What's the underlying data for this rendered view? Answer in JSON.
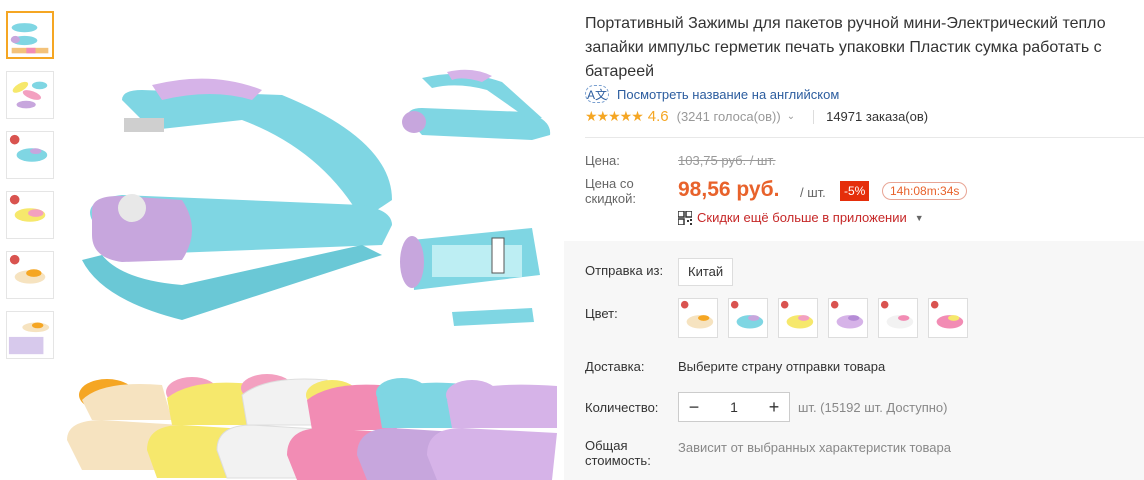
{
  "product": {
    "title": "Портативный Зажимы для пакетов ручной мини-Электрический тепло запайки импульс герметик печать упаковки Пластик сумка работать с батареей",
    "translate_link": "Посмотреть название на английском",
    "translate_icon": "translate-icon",
    "rating": {
      "stars": "★★★★★",
      "value": "4.6",
      "votes": "(3241 голоса(ов))",
      "orders": "14971 заказа(ов)"
    }
  },
  "pricing": {
    "price_label": "Цена:",
    "old_price": "103,75 руб. / шт.",
    "discount_label": "Цена со скидкой:",
    "new_price": "98,56 руб.",
    "per_unit": "/ шт.",
    "discount_badge": "-5%",
    "timer": "14h:08m:34s",
    "app_deal": "Скидки ещё больше в приложении"
  },
  "options": {
    "ship_from_label": "Отправка из:",
    "ship_from_value": "Китай",
    "color_label": "Цвет:",
    "color_swatches": [
      "orange",
      "blue",
      "pink",
      "purple",
      "violet",
      "yellow"
    ],
    "delivery_label": "Доставка:",
    "delivery_value": "Выберите страну отправки товара",
    "quantity_label": "Количество:",
    "quantity_value": "1",
    "quantity_minus": "−",
    "quantity_plus": "+",
    "available": "шт. (15192 шт. Доступно)",
    "total_label": "Общая стоимость:",
    "total_value": "Зависит от выбранных характеристик товара"
  },
  "colors": {
    "accent_orange": "#e8622b",
    "badge_red": "#e52e0b",
    "link_blue": "#2c5d9f",
    "star_gold": "#f5a623",
    "product_teal": "#7fd6e3",
    "product_lilac": "#c7a6dd"
  }
}
